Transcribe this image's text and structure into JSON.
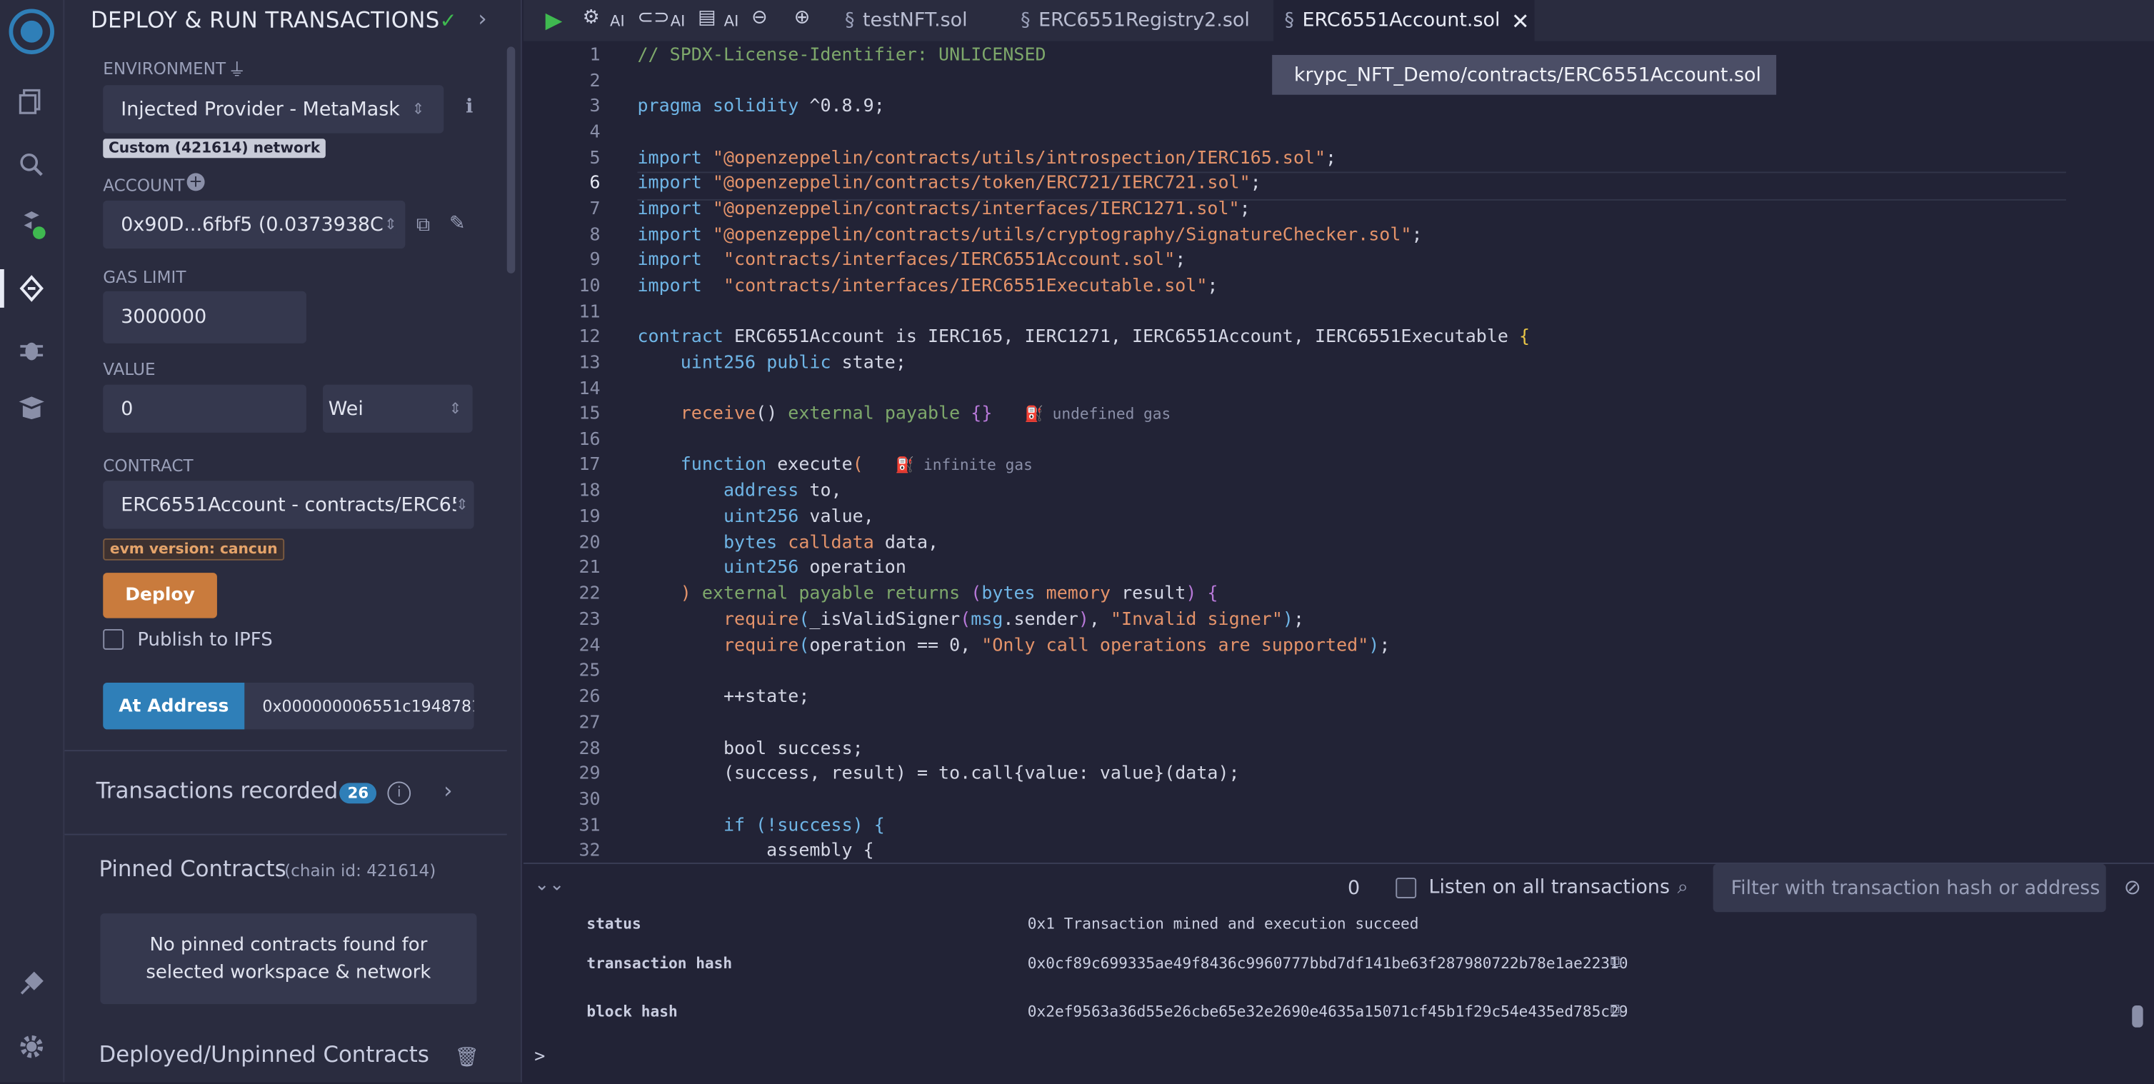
{
  "panel": {
    "title": "DEPLOY & RUN TRANSACTIONS",
    "environment_label": "ENVIRONMENT",
    "environment_value": "Injected Provider - MetaMask",
    "network_badge": "Custom (421614) network",
    "account_label": "ACCOUNT",
    "account_value": "0x90D...6fbf5 (0.0373938C",
    "gas_limit_label": "GAS LIMIT",
    "gas_limit_value": "3000000",
    "value_label": "VALUE",
    "value_value": "0",
    "value_unit": "Wei",
    "contract_label": "CONTRACT",
    "contract_value": "ERC6551Account - contracts/ERC65",
    "evm_badge": "evm version: cancun",
    "deploy_button": "Deploy",
    "publish_label": "Publish to IPFS",
    "at_address_button": "At Address",
    "at_address_value": "0x000000006551c1948781‹",
    "transactions_label": "Transactions recorded",
    "transactions_count": "26",
    "pinned_label": "Pinned Contracts",
    "pinned_chain": "(chain id: 421614)",
    "pinned_empty_line1": "No pinned contracts found for",
    "pinned_empty_line2": "selected workspace & network",
    "deployed_label": "Deployed/Unpinned Contracts"
  },
  "toolbar": {
    "ai_label_1": "AI",
    "ai_label_2": "AI",
    "ai_label_3": "AI"
  },
  "tabs": [
    {
      "label": "testNFT.sol"
    },
    {
      "label": "ERC6551Registry2.sol"
    },
    {
      "label": "ERC6551Account.sol"
    }
  ],
  "tooltip": "krypc_NFT_Demo/contracts/ERC6551Account.sol",
  "code": {
    "line_numbers": [
      "1",
      "2",
      "3",
      "4",
      "5",
      "6",
      "7",
      "8",
      "9",
      "10",
      "11",
      "12",
      "13",
      "14",
      "15",
      "16",
      "17",
      "18",
      "19",
      "20",
      "21",
      "22",
      "23",
      "24",
      "25",
      "26",
      "27",
      "28",
      "29",
      "30",
      "31",
      "32"
    ],
    "l1": "// SPDX-License-Identifier: UNLICENSED",
    "l3a": "pragma solidity",
    "l3b": " ^0.8.9;",
    "l5": "\"@openzeppelin/contracts/utils/introspection/IERC165.sol\"",
    "l6": "\"@openzeppelin/contracts/token/ERC721/IERC721.sol\"",
    "l7": "\"@openzeppelin/contracts/interfaces/IERC1271.sol\"",
    "l8": "\"@openzeppelin/contracts/utils/cryptography/SignatureChecker.sol\"",
    "l9": " \"contracts/interfaces/IERC6551Account.sol\"",
    "l10": " \"contracts/interfaces/IERC6551Executable.sol\"",
    "import_kw": "import",
    "l12": " ERC6551Account is IERC165, IERC1271, IERC6551Account, IERC6551Executable ",
    "l13": " state;",
    "l15_hint": "undefined gas",
    "l17_hint": "infinite gas",
    "l23_str": "\"Invalid signer\"",
    "l24_str": "\"Only call operations are supported\"",
    "l26": "++state;",
    "l28": "bool success;",
    "l29": "(success, result) = to.call{value: value}(data);",
    "l31": "if (!success) {",
    "l32": "assembly {"
  },
  "terminal": {
    "count": "0",
    "listen_label": "Listen on all transactions",
    "filter_placeholder": "Filter with transaction hash or address",
    "rows": [
      {
        "label": "status",
        "value": "0x1 Transaction mined and execution succeed"
      },
      {
        "label": "transaction hash",
        "value": "0x0cf89c699335ae49f8436c9960777bbd7df141be63f287980722b78e1ae22310"
      },
      {
        "label": "block hash",
        "value": "0x2ef9563a36d55e26cbe65e32e2690e4635a15071cf45b1f29c54e435ed785c29"
      }
    ],
    "prompt": ">"
  },
  "colors": {
    "accent_blue": "#2f7fb8",
    "deploy_orange": "#c97b3d",
    "green_check": "#3fb950"
  }
}
